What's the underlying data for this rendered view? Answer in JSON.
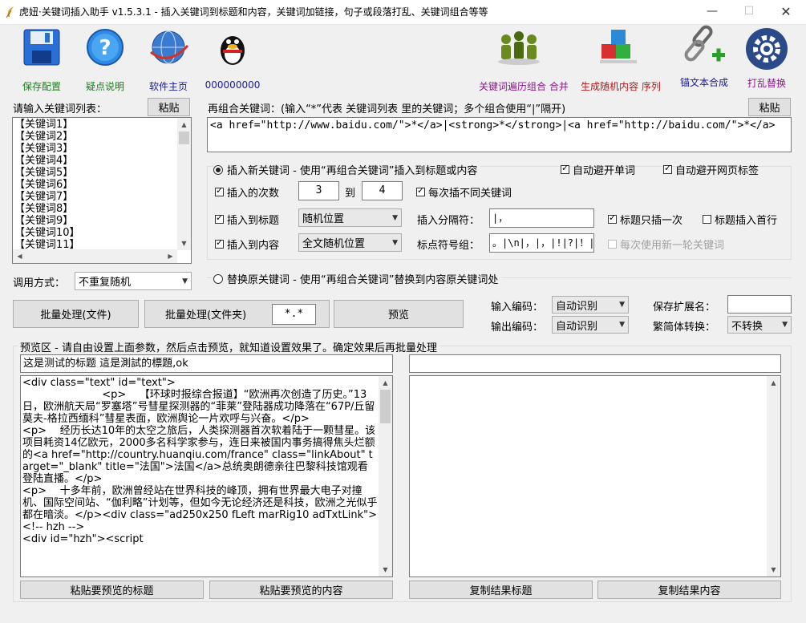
{
  "window": {
    "title": "虎妞·关键词插入助手 v1.5.3.1 - 插入关键词到标题和内容，关键词加链接，句子或段落打乱、关键词组合等等"
  },
  "toolbar": {
    "save": "保存配置",
    "help": "疑点说明",
    "homepage": "软件主页",
    "qq": "000000000",
    "traverse": "关键词遍历组合 合并",
    "random_content": "生成随机内容 序列",
    "anchor": "锚文本合成",
    "shuffle": "打乱替换"
  },
  "keywords": {
    "label": "请输入关键词列表：",
    "paste": "粘贴",
    "items": [
      "【关键词1】",
      "【关键词2】",
      "【关键词3】",
      "【关键词4】",
      "【关键词5】",
      "【关键词6】",
      "【关键词7】",
      "【关键词8】",
      "【关键词9】",
      "【关键词10】",
      "【关键词11】"
    ],
    "call_mode_label": "调用方式：",
    "call_mode_value": "不重复随机"
  },
  "recombine": {
    "label": "再组合关键词：(输入“*”代表 关键词列表 里的关键词；多个组合使用“|”隔开)",
    "paste": "粘贴",
    "value": "<a href=\"http://www.baidu.com/\">*</a>|<strong>*</strong>|<a href=\"http://baidu.com/\">*</a>"
  },
  "insert": {
    "mode_label": "插入新关键词 - 使用“再组合关键词”插入到标题或内容",
    "avoid_word": "自动避开单词",
    "avoid_tag": "自动避开网页标签",
    "times_label": "插入的次数",
    "times_from": "3",
    "to": "到",
    "times_to": "4",
    "diff_each": "每次插不同关键词",
    "to_title": "插入到标题",
    "title_pos": "随机位置",
    "sep_label": "插入分隔符：",
    "sep_value": "|，",
    "title_once": "标题只插一次",
    "title_first": "标题插入首行",
    "to_content": "插入到内容",
    "content_pos": "全文随机位置",
    "punct_label": "标点符号组：",
    "punct_value": "。|\\n|，|，|!|?|！|?",
    "new_round": "每次使用新一轮关键词"
  },
  "replace": {
    "mode_label": "替换原关键词 - 使用“再组合关键词”替换到内容原关键词处"
  },
  "batch": {
    "file": "批量处理(文件)",
    "folder": "批量处理(文件夹)",
    "ext": "*.*",
    "preview": "预览"
  },
  "encoding": {
    "input_label": "输入编码：",
    "input_value": "自动识别",
    "output_label": "输出编码：",
    "output_value": "自动识别",
    "save_ext_label": "保存扩展名：",
    "save_ext_value": "",
    "convert_label": "繁简体转换：",
    "convert_value": "不转换"
  },
  "preview": {
    "label": "预览区 - 请自由设置上面参数，然后点击预览，就知道设置效果了。确定效果后再批量处理",
    "title_value": "这是测试的标题 這是測試的標題,ok",
    "result_title": "",
    "content": "<div class=\"text\" id=\"text\">\n                        <p>    【环球时报综合报道】“欧洲再次创造了历史。”13日，欧洲航天局“罗塞塔”号彗星探测器的“菲莱”登陆器成功降落在“67P/丘留莫夫-格拉西缅科”彗星表面，欧洲舆论一片欢呼与兴奋。</p>\n<p>    经历长达10年的太空之旅后，人类探测器首次软着陆于一颗彗星。该项目耗资14亿欧元，2000多名科学家参与，连日来被国内事务搞得焦头烂额的<a href=\"http://country.huanqiu.com/france\" class=\"linkAbout\" target=\"_blank\" title=\"法国\">法国</a>总统奥朗德亲往巴黎科技馆观看登陆直播。</p>\n<p>    十多年前，欧洲曾经站在世界科技的峰顶，拥有世界最大电子对撞机、国际空间站、“伽利略”计划等，但如今无论经济还是科技，欧洲之光似乎都在暗淡。</p><div class=\"ad250x250 fLeft marRig10 adTxtLink\">\n<!-- hzh -->\n<div id=\"hzh\"><script",
    "result_content": "",
    "paste_title": "粘贴要预览的标题",
    "paste_content": "粘贴要预览的内容",
    "copy_title": "复制结果标题",
    "copy_content": "复制结果内容"
  }
}
